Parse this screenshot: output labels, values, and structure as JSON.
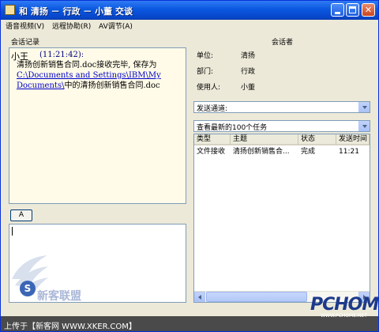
{
  "window": {
    "title": "和 清扬 － 行政 － 小董 交谈"
  },
  "menu": [
    "语音视频(V)",
    "远程协助(R)",
    "AV调节(A)"
  ],
  "chat": {
    "group_label": "会话记录",
    "sender": "小王",
    "time": "(11:21:42):",
    "message_line1": "清扬创新销售合同.doc接收完毕, 保存为",
    "message_path": "C:\\Documents and Settings\\IBM\\My Documents\\",
    "message_tail": "中的清扬创新销售合同.doc"
  },
  "font_button": "A",
  "contact": {
    "group_label": "会话者",
    "unit_label": "单位:",
    "unit_value": "清扬",
    "dept_label": "部门:",
    "dept_value": "行政",
    "user_label": "使用人:",
    "user_value": "小董"
  },
  "send_channel": {
    "value": "发送通道:"
  },
  "task_filter": {
    "value": "查看最新的100个任务"
  },
  "task_table": {
    "columns": [
      "类型",
      "主题",
      "状态",
      "发送时间"
    ],
    "rows": [
      [
        "文件接收",
        "清扬创新销售合...",
        "完成",
        "11:21"
      ]
    ]
  },
  "watermark": {
    "footer": "上传于【新客网 WWW.XKER.COM】",
    "brand": "PCHOME",
    "brand_url": "WWW.PCHOME.NET",
    "left_logo_text": "新客联盟"
  },
  "colors": {
    "titlebar": "#0a58e0",
    "window_bg": "#ece9d8",
    "chat_bg": "#fffbe8",
    "link": "#0000cc"
  }
}
